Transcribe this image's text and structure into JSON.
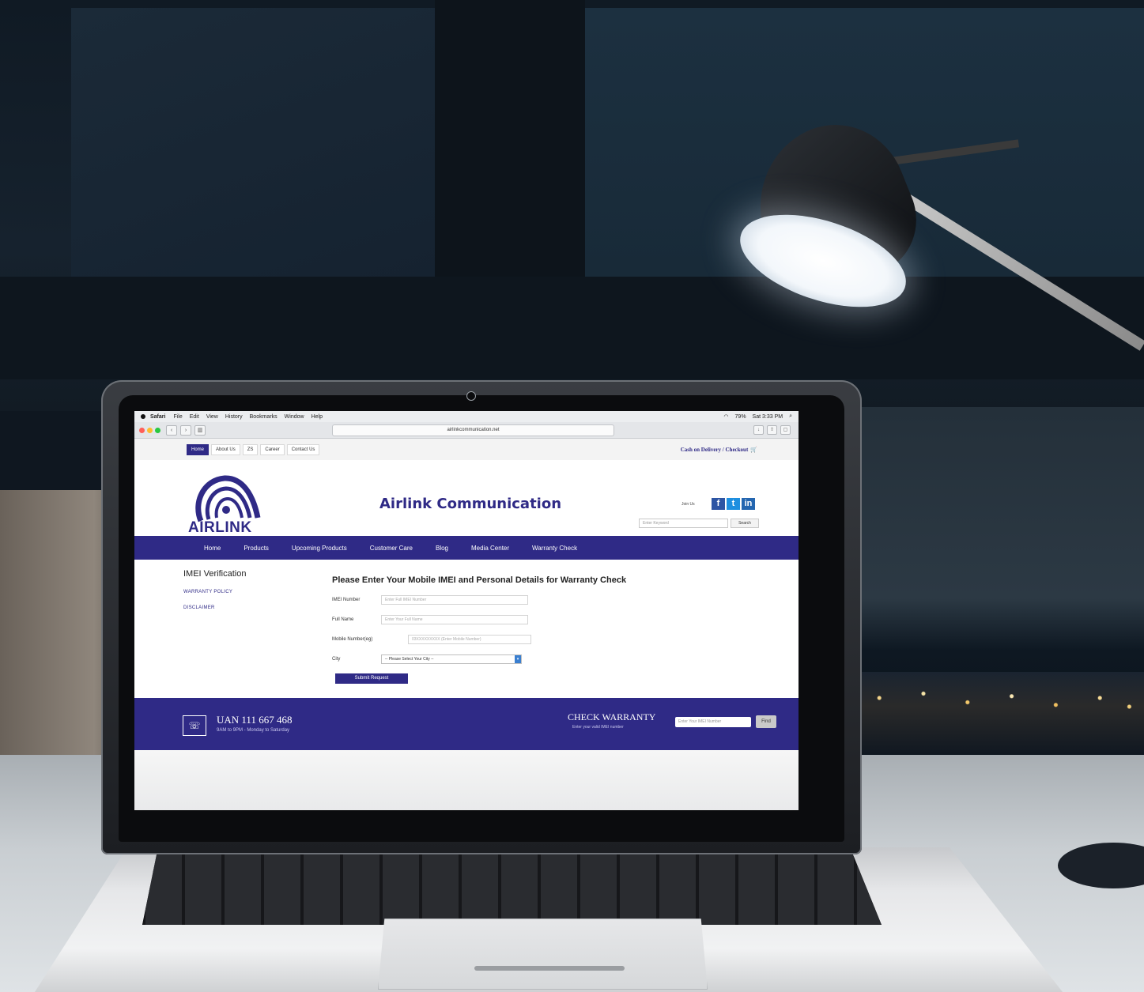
{
  "macos_menubar": {
    "app": "Safari",
    "menus": [
      "File",
      "Edit",
      "View",
      "History",
      "Bookmarks",
      "Window",
      "Help"
    ],
    "status": {
      "battery": "79%",
      "clock": "Sat 3:33 PM"
    }
  },
  "browser": {
    "url": "airlinkcommunication.net"
  },
  "top_nav": {
    "links": [
      "Home",
      "About Us",
      "ZS",
      "Career",
      "Contact Us"
    ],
    "cod_text": "Cash on Delivery / Checkout"
  },
  "header": {
    "logo_text": "AIRLINK",
    "site_title": "Airlink Communication",
    "join_text": "Join Us",
    "social": [
      "facebook-icon",
      "twitter-icon",
      "linkedin-icon"
    ],
    "search_placeholder": "Enter Keyword",
    "search_button": "Search"
  },
  "main_nav": {
    "items": [
      "Home",
      "Products",
      "Upcoming Products",
      "Customer Care",
      "Blog",
      "Media Center",
      "Warranty Check"
    ]
  },
  "sidebar": {
    "title": "IMEI Verification",
    "links": [
      "WARRANTY POLICY",
      "DISCLAIMER"
    ]
  },
  "form": {
    "title": "Please Enter Your Mobile IMEI and Personal Details for Warranty Check",
    "fields": [
      {
        "label": "IMEI Number",
        "placeholder": "Enter Full IMEI Number"
      },
      {
        "label": "Full Name",
        "placeholder": "Enter Your Full Name"
      },
      {
        "label": "Mobile Number(eg)",
        "placeholder": "03XXXXXXXXX (Enter Mobile Number)"
      }
    ],
    "city_label": "City",
    "city_select": "-- Please Select Your City --",
    "submit": "Submit Request"
  },
  "footer": {
    "uan": "UAN 111 667 468",
    "hours": "9AM to 9PM - Monday to Saturday",
    "cw_title": "CHECK WARRANTY",
    "cw_sub": "Enter your valid IMEI number",
    "cw_placeholder": "Enter Your IMEI Number",
    "cw_button": "Find"
  }
}
